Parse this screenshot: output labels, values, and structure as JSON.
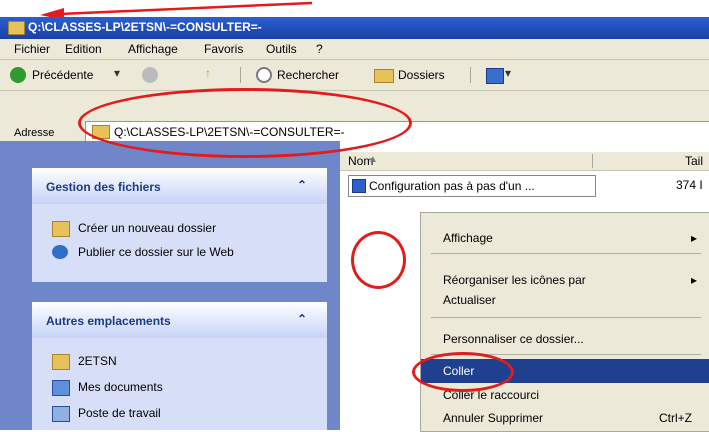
{
  "window": {
    "title": "Q:\\CLASSES-LP\\2ETSN\\-=CONSULTER=-",
    "menu": [
      "Fichier",
      "Edition",
      "Affichage",
      "Favoris",
      "Outils",
      "?"
    ],
    "toolbar": {
      "back": "Précédente",
      "search": "Rechercher",
      "folders": "Dossiers"
    },
    "address": {
      "label": "Adresse",
      "value": "Q:\\CLASSES-LP\\2ETSN\\-=CONSULTER=-"
    }
  },
  "left_panel": {
    "file_tasks": {
      "title": "Gestion des fichiers",
      "items": [
        "Créer un nouveau dossier",
        "Publier ce dossier sur le Web"
      ]
    },
    "other_places": {
      "title": "Autres emplacements",
      "items": [
        "2ETSN",
        "Mes documents",
        "Poste de travail"
      ]
    }
  },
  "file_list": {
    "columns": [
      "Nom",
      "Tail"
    ],
    "rows": [
      {
        "name": "Configuration pas à pas d'un ...",
        "size": "374 I"
      }
    ]
  },
  "context_menu": {
    "items": [
      {
        "label": "Affichage",
        "arrow": "▸",
        "shortcut": ""
      },
      {
        "label": "Réorganiser les icônes par",
        "arrow": "▸",
        "shortcut": ""
      },
      {
        "label": "Actualiser",
        "arrow": "",
        "shortcut": ""
      },
      {
        "label": "Personnaliser ce dossier...",
        "arrow": "",
        "shortcut": ""
      },
      {
        "label": "Coller",
        "arrow": "",
        "shortcut": ""
      },
      {
        "label": "Coller le raccourci",
        "arrow": "",
        "shortcut": ""
      },
      {
        "label": "Annuler Supprimer",
        "arrow": "",
        "shortcut": "Ctrl+Z"
      }
    ]
  },
  "colors": {
    "annotation_red": "#e21c1c",
    "titlebar_blue": "#1a3fa8",
    "selection_blue": "#1f3f8f",
    "panel_blue": "#6f87c9"
  }
}
